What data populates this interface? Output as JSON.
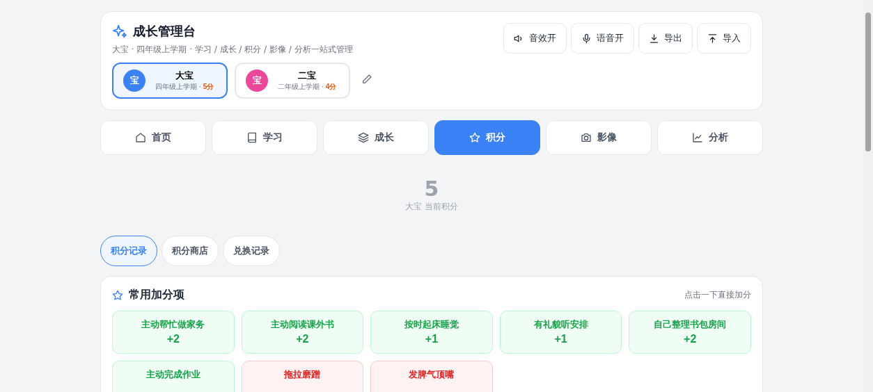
{
  "header": {
    "title": "成长管理台",
    "subtitle": "大宝 · 四年级上学期 · 学习 / 成长 / 积分 / 影像 / 分析一站式管理",
    "actions": [
      {
        "kind": "sound",
        "label": "音效开"
      },
      {
        "kind": "mic",
        "label": "语音开"
      },
      {
        "kind": "export",
        "label": "导出"
      },
      {
        "kind": "import",
        "label": "导入"
      }
    ],
    "children": [
      {
        "avatar": "宝",
        "name": "大宝",
        "grade": "四年级上学期",
        "separator": "·",
        "points": "5分",
        "selected": true,
        "color": "#3b82f6"
      },
      {
        "avatar": "宝",
        "name": "二宝",
        "grade": "二年级上学期",
        "separator": "·",
        "points": "4分",
        "selected": false,
        "color": "#ec4899"
      }
    ]
  },
  "nav": [
    {
      "kind": "home",
      "label": "首页",
      "selected": false
    },
    {
      "kind": "book",
      "label": "学习",
      "selected": false
    },
    {
      "kind": "layers",
      "label": "成长",
      "selected": false
    },
    {
      "kind": "star",
      "label": "积分",
      "selected": true
    },
    {
      "kind": "camera",
      "label": "影像",
      "selected": false
    },
    {
      "kind": "chart",
      "label": "分析",
      "selected": false
    }
  ],
  "score": {
    "value": "5",
    "caption": "大宝 当前积分"
  },
  "subtabs": [
    {
      "label": "积分记录",
      "selected": true
    },
    {
      "label": "积分商店",
      "selected": false
    },
    {
      "label": "兑换记录",
      "selected": false
    }
  ],
  "quick": {
    "title": "常用加分项",
    "hint": "点击一下直接加分",
    "items": [
      {
        "kind": "plus",
        "label": "主动帮忙做家务",
        "points": "+2"
      },
      {
        "kind": "plus",
        "label": "主动阅读课外书",
        "points": "+2"
      },
      {
        "kind": "plus",
        "label": "按时起床睡觉",
        "points": "+1"
      },
      {
        "kind": "plus",
        "label": "有礼貌听安排",
        "points": "+1"
      },
      {
        "kind": "plus",
        "label": "自己整理书包房间",
        "points": "+2"
      },
      {
        "kind": "plus",
        "label": "主动完成作业"
      },
      {
        "kind": "minus",
        "label": "拖拉磨蹭"
      },
      {
        "kind": "minus",
        "label": "发脾气顶嘴"
      }
    ]
  }
}
